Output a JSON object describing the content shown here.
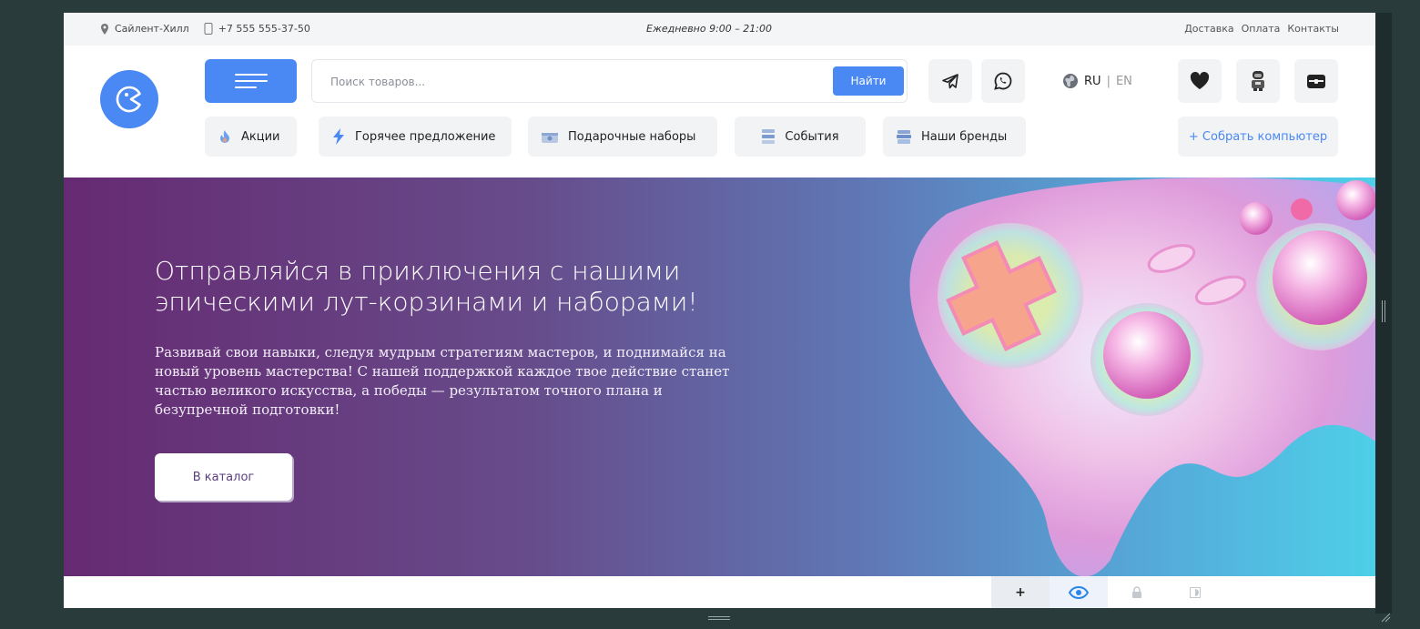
{
  "topbar": {
    "location": "Сайлент-Хилл",
    "phone": "+7 555 555-37-50",
    "hours": "Ежедневно  9:00 – 21:00",
    "links": [
      "Доставка",
      "Оплата",
      "Контакты"
    ]
  },
  "search": {
    "placeholder": "Поиск товаров...",
    "button": "Найти"
  },
  "lang": {
    "current": "RU",
    "separator": "|",
    "other": "EN"
  },
  "nav": {
    "items": [
      "Акции",
      "Горячее предложение",
      "Подарочные наборы",
      "События",
      "Наши бренды"
    ],
    "build": "+ Собрать компьютер"
  },
  "hero": {
    "title": "Отправляйся в приключения с нашими эпическими лут-корзинами и наборами!",
    "text": "Развивай свои навыки, следуя мудрым стратегиям мастеров, и поднимайся на новый уровень мастерства! С нашей поддержкой каждое твое действие станет частью великого искусства, а победы — результатом точного плана и безупречной подготовки!",
    "cta": "В каталог"
  },
  "toolbar": {
    "add": "+"
  },
  "colors": {
    "accent": "#4a88f3",
    "hero_start": "#662a72",
    "hero_end": "#4ecfe8"
  }
}
